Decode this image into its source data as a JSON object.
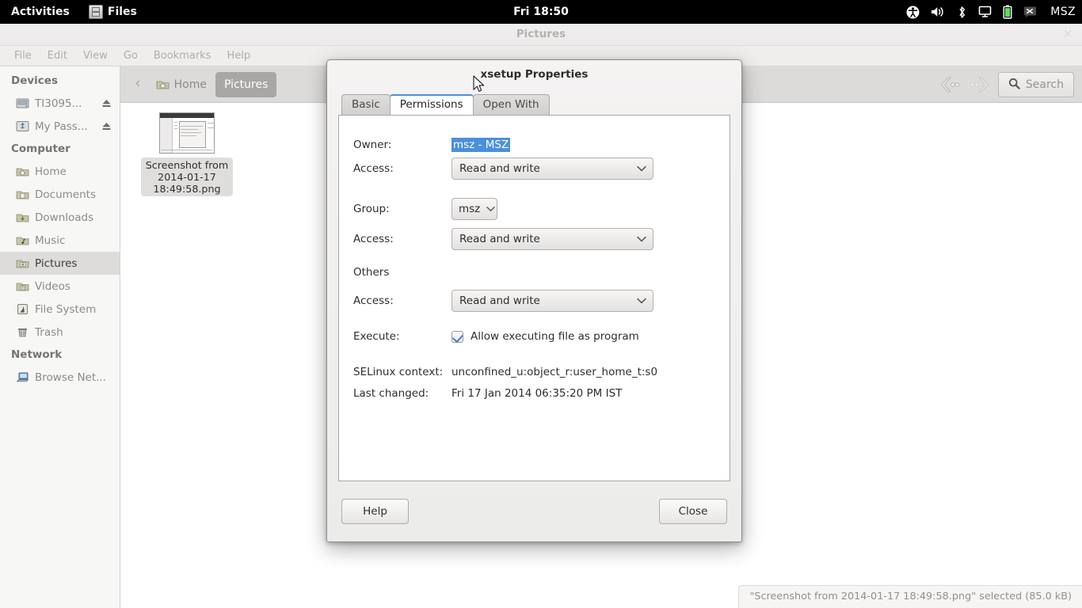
{
  "topbar": {
    "activities": "Activities",
    "app_name": "Files",
    "app_icon": "files-icon",
    "clock": "Fri 18:50",
    "tray_icons": [
      "accessibility-icon",
      "volume-icon",
      "bluetooth-icon",
      "display-icon",
      "battery-icon",
      "input-source-icon"
    ],
    "username": "MSZ"
  },
  "window": {
    "title": "Pictures",
    "close_label": "✕",
    "menus": [
      "File",
      "Edit",
      "View",
      "Go",
      "Bookmarks",
      "Help"
    ]
  },
  "sidebar": {
    "sections": [
      {
        "title": "Devices",
        "items": [
          {
            "label": "TI3095...",
            "icon": "drive-icon",
            "eject": true,
            "selected": false
          },
          {
            "label": "My Pass...",
            "icon": "usb-drive-icon",
            "eject": true,
            "selected": false
          }
        ]
      },
      {
        "title": "Computer",
        "items": [
          {
            "label": "Home",
            "icon": "home-folder-icon",
            "eject": false,
            "selected": false
          },
          {
            "label": "Documents",
            "icon": "documents-folder-icon",
            "eject": false,
            "selected": false
          },
          {
            "label": "Downloads",
            "icon": "downloads-folder-icon",
            "eject": false,
            "selected": false
          },
          {
            "label": "Music",
            "icon": "music-folder-icon",
            "eject": false,
            "selected": false
          },
          {
            "label": "Pictures",
            "icon": "pictures-folder-icon",
            "eject": false,
            "selected": true
          },
          {
            "label": "Videos",
            "icon": "videos-folder-icon",
            "eject": false,
            "selected": false
          },
          {
            "label": "File System",
            "icon": "filesystem-icon",
            "eject": false,
            "selected": false
          },
          {
            "label": "Trash",
            "icon": "trash-icon",
            "eject": false,
            "selected": false
          }
        ]
      },
      {
        "title": "Network",
        "items": [
          {
            "label": "Browse Net...",
            "icon": "network-icon",
            "eject": false,
            "selected": false
          }
        ]
      }
    ]
  },
  "pathbar": {
    "back_arrow": "‹",
    "crumbs": [
      {
        "label": "Home",
        "icon": "home-folder-icon",
        "active": false
      },
      {
        "label": "Pictures",
        "icon": "",
        "active": true
      }
    ],
    "search_label": "Search",
    "search_icon": "search-icon",
    "nav_back_icon": "nav-back-icon",
    "nav_forward_icon": "nav-forward-icon"
  },
  "files": [
    {
      "name": "Screenshot from 2014-01-17 18:49:58.png",
      "selected": true,
      "icon": "image-thumbnail"
    }
  ],
  "statusbar": {
    "text": "\"Screenshot from 2014-01-17 18:49:58.png\" selected (85.0 kB)"
  },
  "dialog": {
    "title": "xsetup Properties",
    "tabs": [
      {
        "label": "Basic",
        "active": false
      },
      {
        "label": "Permissions",
        "active": true
      },
      {
        "label": "Open With",
        "active": false
      }
    ],
    "fields": {
      "owner_label": "Owner:",
      "owner_value": "msz - MSZ",
      "owner_access_label": "Access:",
      "owner_access_value": "Read and write",
      "group_label": "Group:",
      "group_value": "msz",
      "group_access_label": "Access:",
      "group_access_value": "Read and write",
      "others_label": "Others",
      "others_access_label": "Access:",
      "others_access_value": "Read and write",
      "execute_label": "Execute:",
      "execute_checkbox_label": "Allow executing file as program",
      "execute_checked": true,
      "selinux_label": "SELinux context:",
      "selinux_value": "unconfined_u:object_r:user_home_t:s0",
      "lastchanged_label": "Last changed:",
      "lastchanged_value": "Fri 17 Jan 2014 06:35:20 PM IST"
    },
    "buttons": {
      "help": "Help",
      "close": "Close"
    }
  },
  "colors": {
    "selection_blue": "#4a90d9",
    "topbar_black": "#000000",
    "sidebar_bg": "#f7f7f6",
    "pathbar_bg": "#dcdbd9"
  }
}
